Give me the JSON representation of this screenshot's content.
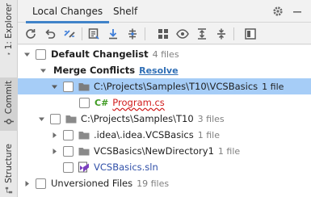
{
  "side_panel": {
    "explorer_label": "1: Explorer",
    "commit_label": "Commit",
    "structure_label": "Structure"
  },
  "header": {
    "tabs": [
      {
        "label": "Local Changes",
        "active": true
      },
      {
        "label": "Shelf",
        "active": false
      }
    ]
  },
  "toolbar": {
    "icons": [
      "refresh-icon",
      "rollback-icon",
      "diff-icon",
      "changelist-icon",
      "update-icon",
      "shelve-icon",
      "group-by-icon",
      "show-options-icon",
      "expand-all-icon",
      "collapse-all-icon",
      "preview-icon"
    ]
  },
  "tree": {
    "changelist": {
      "label": "Default Changelist",
      "meta": "4 files"
    },
    "merge_conflicts": {
      "label": "Merge Conflicts",
      "action": "Resolve"
    },
    "conflict_dir": {
      "label": "C:\\Projects\\Samples\\T10\\VCSBasics",
      "meta": "1 file"
    },
    "conflict_file": {
      "icon_text": "C#",
      "label": "Program.cs"
    },
    "t10_dir": {
      "label": "C:\\Projects\\Samples\\T10",
      "meta": "3 files"
    },
    "idea_dir": {
      "label": ".idea\\.idea.VCSBasics",
      "meta": "1 file"
    },
    "new_dir": {
      "label": "VCSBasics\\NewDirectory1",
      "meta": "1 file"
    },
    "sln_file": {
      "label": "VCSBasics.sln"
    },
    "unversioned": {
      "label": "Unversioned Files",
      "meta": "19 files"
    }
  },
  "colors": {
    "accent": "#4083c9",
    "selection": "#a6cdf7",
    "link": "#2f6eb5",
    "conflict": "#d11c1c",
    "csharp": "#3f9b22"
  }
}
